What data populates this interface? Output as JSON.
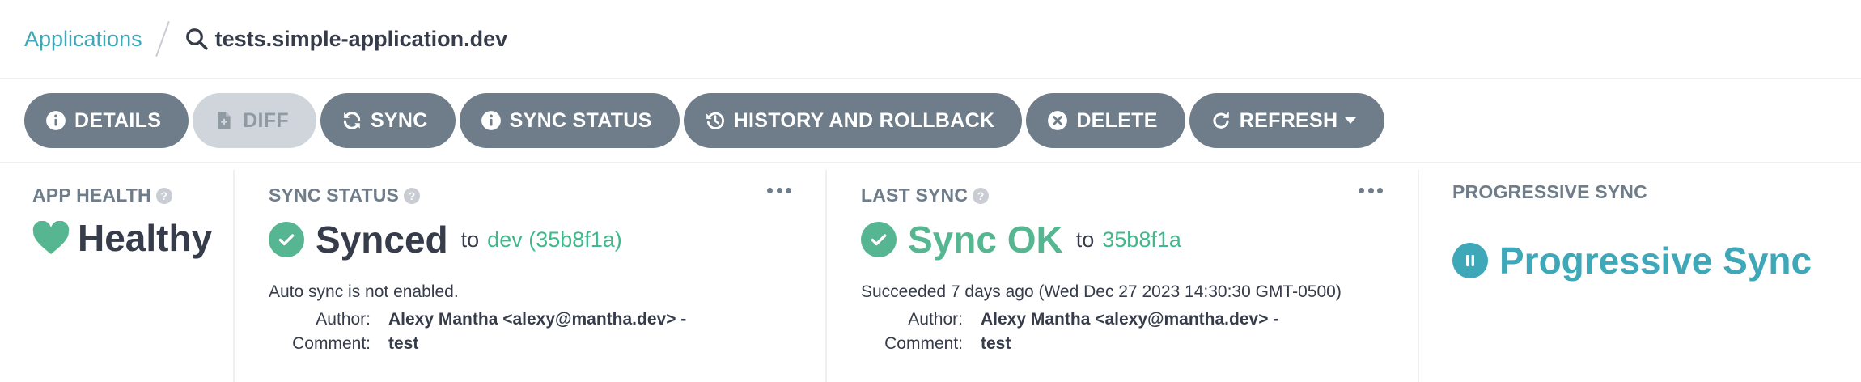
{
  "breadcrumb": {
    "root_label": "Applications",
    "current": "tests.simple-application.dev"
  },
  "toolbar": {
    "details": "DETAILS",
    "diff": "DIFF",
    "sync": "SYNC",
    "sync_status": "SYNC STATUS",
    "history": "HISTORY AND ROLLBACK",
    "delete": "DELETE",
    "refresh": "REFRESH"
  },
  "app_health": {
    "title": "APP HEALTH",
    "status": "Healthy",
    "color": "#56b691"
  },
  "sync_status": {
    "title": "SYNC STATUS",
    "status": "Synced",
    "to_label": "to",
    "revision": "dev (35b8f1a)",
    "note": "Auto sync is not enabled.",
    "author_label": "Author:",
    "author": "Alexy Mantha <alexy@mantha.dev> -",
    "comment_label": "Comment:",
    "comment": "test"
  },
  "last_sync": {
    "title": "LAST SYNC",
    "status": "Sync OK",
    "to_label": "to",
    "revision": "35b8f1a",
    "note": "Succeeded 7 days ago (Wed Dec 27 2023 14:30:30 GMT-0500)",
    "author_label": "Author:",
    "author": "Alexy Mantha <alexy@mantha.dev> -",
    "comment_label": "Comment:",
    "comment": "test"
  },
  "progressive_sync": {
    "title": "PROGRESSIVE SYNC",
    "status": "Progressive Sync",
    "color": "#3fa8b8"
  },
  "colors": {
    "accent": "#3fa8b8",
    "success": "#56b691",
    "button": "#6e7d89",
    "button_disabled": "#cfd5da"
  }
}
